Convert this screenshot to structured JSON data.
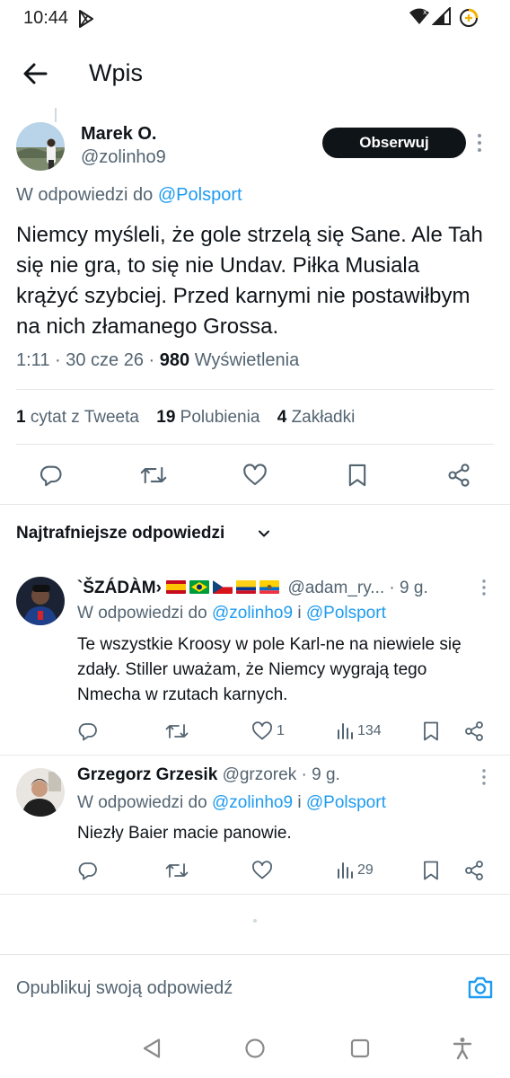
{
  "status_bar": {
    "time": "10:44"
  },
  "header": {
    "title": "Wpis"
  },
  "main_tweet": {
    "name": "Marek O.",
    "handle": "@zolinho9",
    "follow_label": "Obserwuj",
    "reply_to_prefix": "W odpowiedzi do",
    "reply_to_handle": "@Polsport",
    "text": "Niemcy myśleli, że gole strzelą się Sane. Ale Tah się nie gra, to się nie Undav. Piłka Musiala krążyć szybciej. Przed karnymi nie postawiłbym na nich złamanego Grossa.",
    "time": "1:11",
    "date": "30 cze 26",
    "views_count": "980",
    "views_label": "Wyświetlenia",
    "stats": [
      {
        "num": "1",
        "label": "cytat z Tweeta"
      },
      {
        "num": "19",
        "label": "Polubienia"
      },
      {
        "num": "4",
        "label": "Zakładki"
      }
    ]
  },
  "replies_header": {
    "label": "Najtrafniejsze odpowiedzi"
  },
  "replies": [
    {
      "name": "`ŠZÁDÀM›",
      "flags": [
        "spain-flag",
        "brazil-flag",
        "czech-flag",
        "colombia-flag",
        "ecuador-flag"
      ],
      "handle": "@adam_ry...",
      "time": "· 9 g.",
      "reply_to_prefix": "W odpowiedzi do",
      "reply_to_1": "@zolinho9",
      "reply_to_joiner": "i",
      "reply_to_2": "@Polsport",
      "text": "Te wszystkie Kroosy w pole Karl-ne na niewiele się zdały. Stiller uważam, że Niemcy wygrają tego Nmecha w rzutach karnych.",
      "likes": "1",
      "views": "134"
    },
    {
      "name": "Grzegorz Grzesik",
      "handle": "@grzorek",
      "time": "· 9 g.",
      "reply_to_prefix": "W odpowiedzi do",
      "reply_to_1": "@zolinho9",
      "reply_to_joiner": "i",
      "reply_to_2": "@Polsport",
      "text": "Niezły Baier macie panowie.",
      "likes": "",
      "views": "29"
    }
  ],
  "compose": {
    "placeholder": "Opublikuj swoją odpowiedź"
  },
  "colors": {
    "accent": "#1d9bf0",
    "text": "#0f1419",
    "muted": "#536471"
  }
}
